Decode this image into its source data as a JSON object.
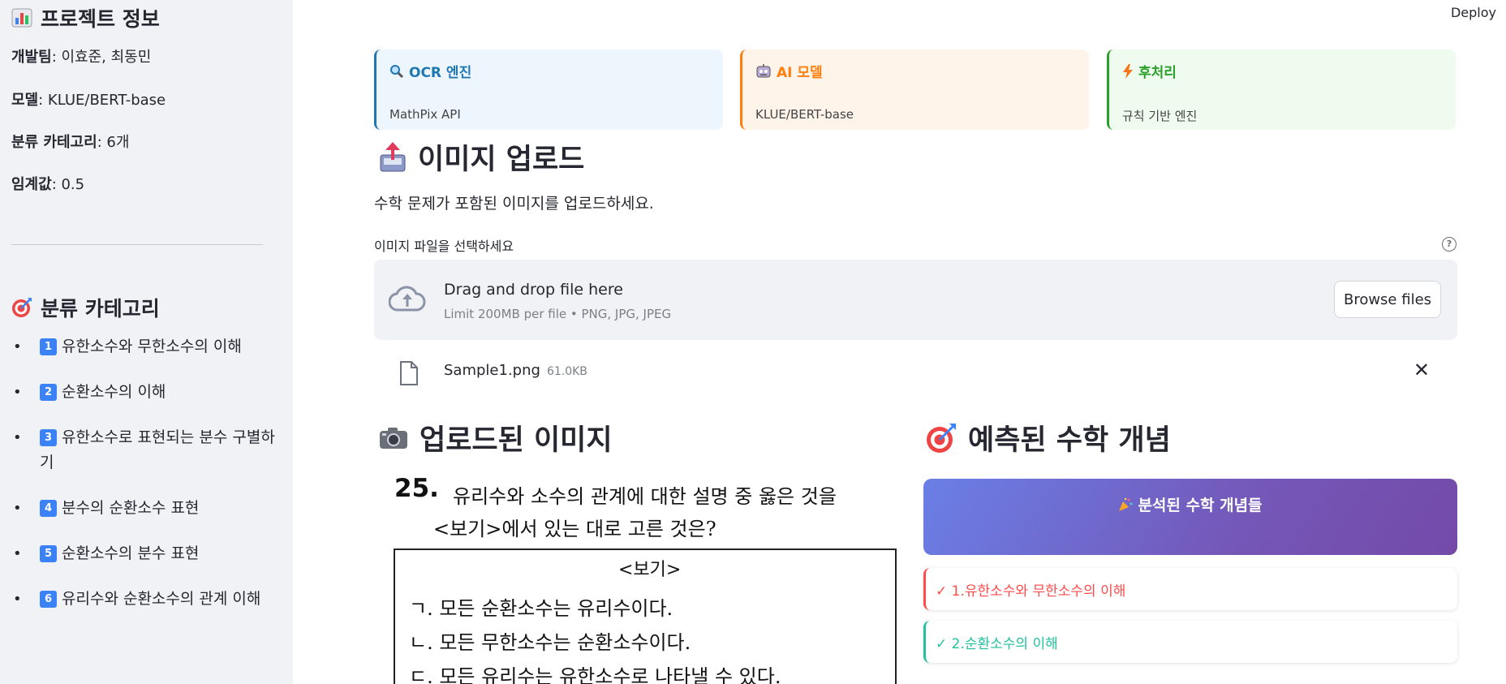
{
  "header": {
    "deploy_label": "Deploy"
  },
  "sidebar": {
    "project_title": "프로젝트 정보",
    "info": [
      {
        "label": "개발팀",
        "value": ": 이효준, 최동민"
      },
      {
        "label": "모델",
        "value": ": KLUE/BERT-base"
      },
      {
        "label": "분류 카테고리",
        "value": ": 6개"
      },
      {
        "label": "임계값",
        "value": ": 0.5"
      }
    ],
    "category_title": "분류 카테고리",
    "categories": [
      {
        "num": "1",
        "label": "유한소수와 무한소수의 이해"
      },
      {
        "num": "2",
        "label": "순환소수의 이해"
      },
      {
        "num": "3",
        "label": "유한소수로 표현되는 분수 구별하기"
      },
      {
        "num": "4",
        "label": "분수의 순환소수 표현"
      },
      {
        "num": "5",
        "label": "순환소수의 분수 표현"
      },
      {
        "num": "6",
        "label": "유리수와 순환소수의 관계 이해"
      }
    ]
  },
  "cards": [
    {
      "title": "OCR 엔진",
      "subtitle": "MathPix API",
      "color": "#1f77b4",
      "bg": "#eef6fd"
    },
    {
      "title": "AI 모델",
      "subtitle": "KLUE/BERT-base",
      "color": "#ff7f0e",
      "bg": "#fff4ea"
    },
    {
      "title": "후처리",
      "subtitle": "규칙 기반 엔진",
      "color": "#2ca02c",
      "bg": "#effbef"
    }
  ],
  "upload": {
    "title": "이미지 업로드",
    "description": "수학 문제가 포함된 이미지를 업로드하세요.",
    "file_label": "이미지 파일을 선택하세요",
    "drop_text": "Drag and drop file here",
    "limit_text": "Limit 200MB per file • PNG, JPG, JPEG",
    "browse_label": "Browse files",
    "file_name": "Sample1.png",
    "file_size": "61.0KB"
  },
  "uploaded_image": {
    "title": "업로드된 이미지",
    "problem_number": "25.",
    "line1": "유리수와 소수의 관계에 대한 설명 중 옳은 것을",
    "line2": "<보기>에서 있는 대로 고른 것은?",
    "box_title": "<보기>",
    "items": [
      "ㄱ. 모든 순환소수는 유리수이다.",
      "ㄴ. 모든 무한소수는 순환소수이다.",
      "ㄷ. 모든 유리수는 유한소수로 나타낼 수 있다."
    ]
  },
  "prediction": {
    "title": "예측된 수학 개념",
    "banner": "분석된 수학 개념들",
    "concepts": [
      {
        "text": "✓ 1.유한소수와 무한소수의 이해",
        "color": "#ff4b4b"
      },
      {
        "text": "✓ 2.순환소수의 이해",
        "color": "#20c0a0"
      }
    ]
  }
}
